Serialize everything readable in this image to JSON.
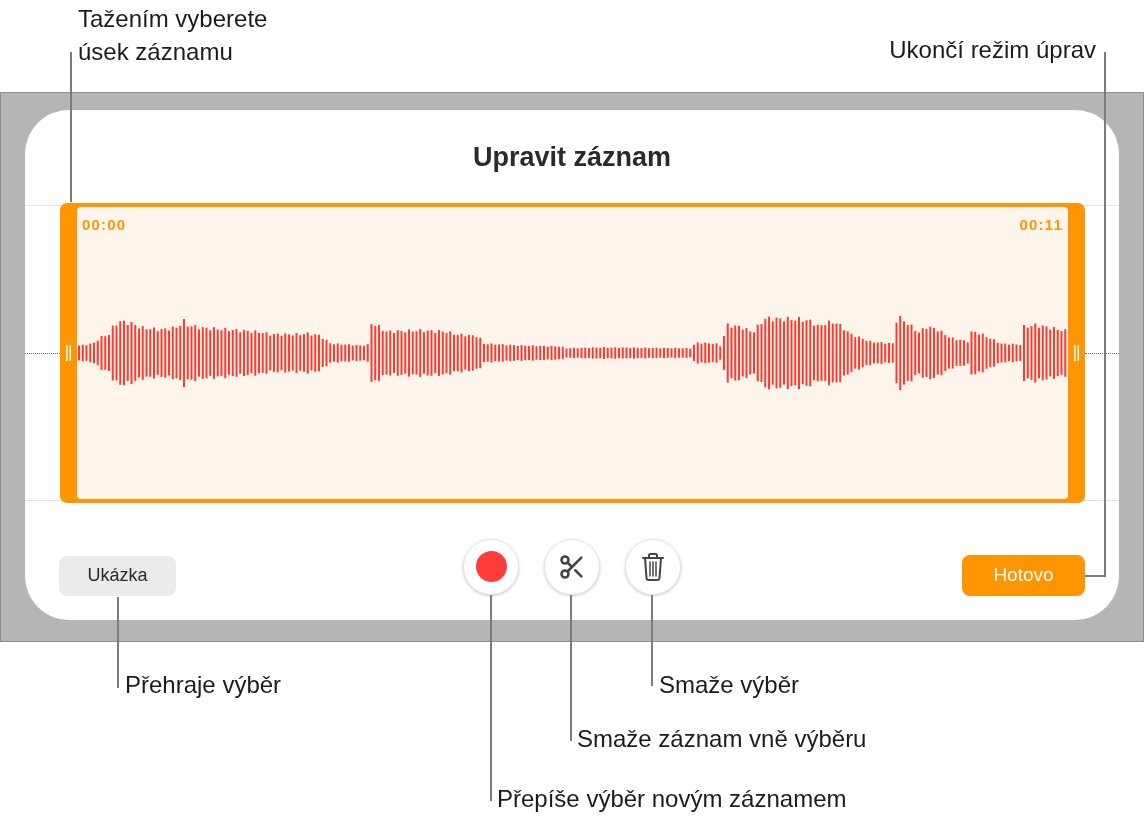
{
  "dialog": {
    "title": "Upravit záznam",
    "selection": {
      "start_time": "00:00",
      "end_time": "00:11"
    },
    "preview_button": {
      "label": "Ukázka"
    },
    "tools": [
      {
        "kind": "record"
      },
      {
        "kind": "trim"
      },
      {
        "kind": "delete"
      }
    ],
    "done_button": {
      "label": "Hotovo"
    }
  },
  "callouts": [
    {
      "kind": "selection",
      "text": "Tažením vyberete úsek záznamu"
    },
    {
      "kind": "done",
      "text": "Ukončí režim úprav"
    },
    {
      "kind": "preview",
      "text": "Přehraje výběr"
    },
    {
      "kind": "delete",
      "text": "Smaže výběr"
    },
    {
      "kind": "trim",
      "text": "Smaže záznam vně výběru"
    },
    {
      "kind": "record",
      "text": "Přepíše výběr novým záznamem"
    }
  ]
}
